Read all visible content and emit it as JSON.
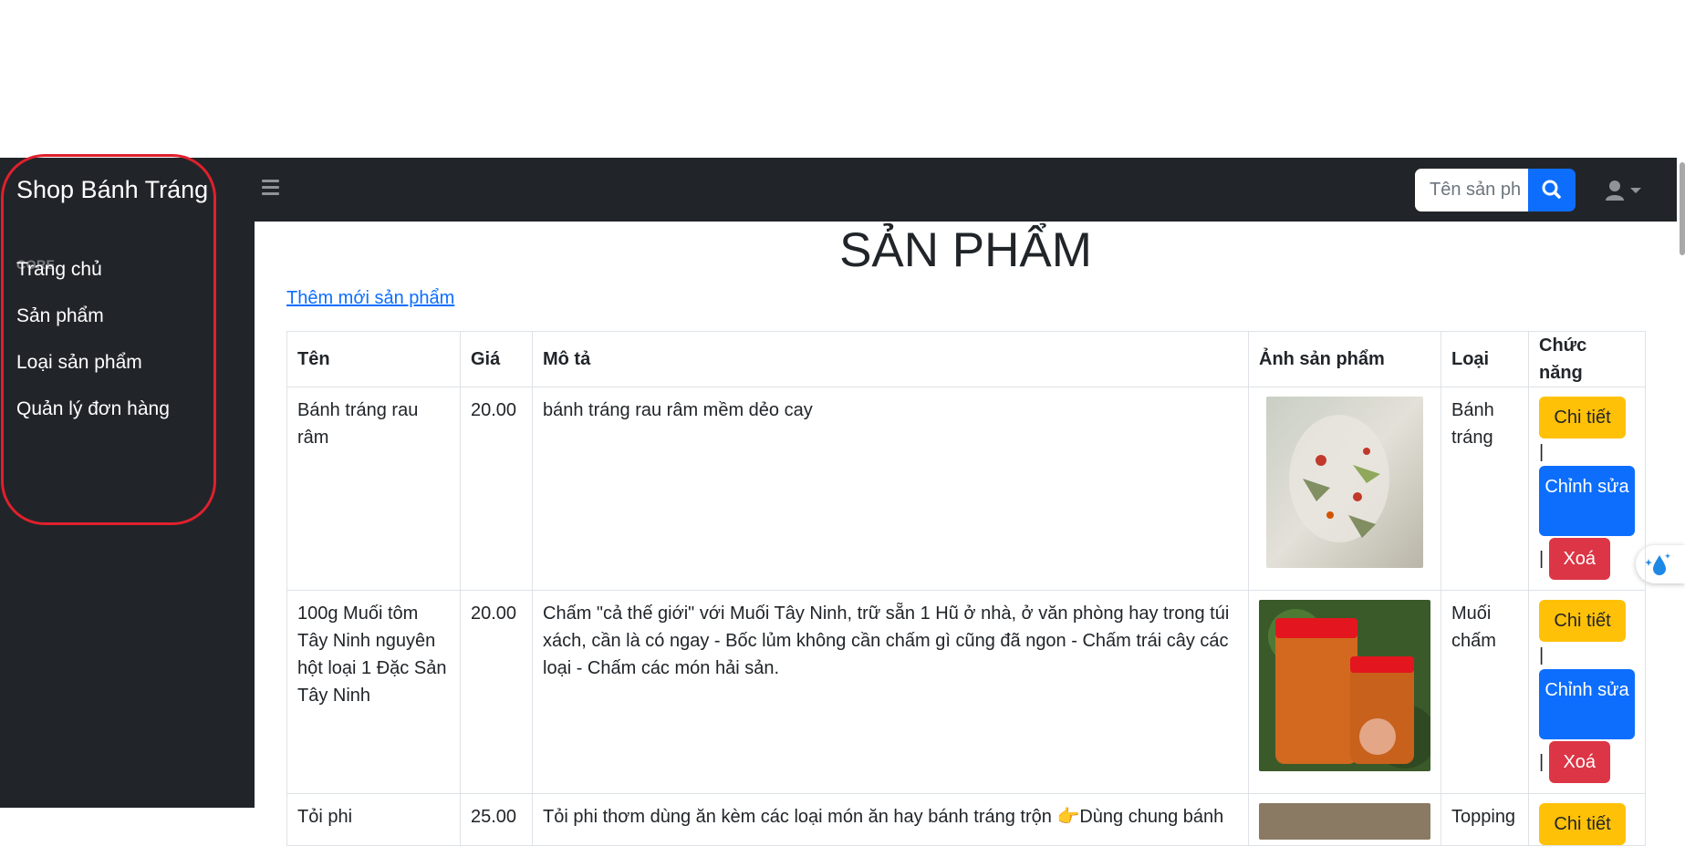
{
  "brand": "Shop Bánh Tráng",
  "sidebar": {
    "heading": "CORE",
    "items": [
      {
        "label": "Trang chủ"
      },
      {
        "label": "Sản phẩm"
      },
      {
        "label": "Loại sản phẩm"
      },
      {
        "label": "Quản lý đơn hàng"
      }
    ]
  },
  "search": {
    "placeholder": "Tên sản phẩm",
    "value": "Tên sản ph"
  },
  "icons": {
    "menu": "hamburger-icon",
    "search": "search-icon",
    "user": "user-icon",
    "dropdown": "caret-down-icon",
    "floating": "water-drop-sparkle-icon"
  },
  "main": {
    "title": "SẢN PHẨM",
    "add_link": "Thêm mới sản phẩm"
  },
  "table": {
    "headers": [
      "Tên",
      "Giá",
      "Mô tả",
      "Ảnh sản phẩm",
      "Loại",
      "Chức năng"
    ],
    "rows": [
      {
        "name": "Bánh tráng rau râm",
        "price": "20.00",
        "description": "bánh tráng rau râm mềm dẻo cay",
        "category": "Bánh tráng"
      },
      {
        "name": "100g Muối tôm Tây Ninh nguyên hột loại 1 Đặc Sản Tây Ninh",
        "price": "20.00",
        "description": "Chấm \"cả thế giới\" với Muối Tây Ninh, trữ sẵn 1 Hũ ở nhà, ở văn phòng hay trong túi xách, cần là có ngay - Bốc lủm không cần chấm gì cũng đã ngon - Chấm trái cây các loại - Chấm các món hải sản.",
        "category": "Muối chấm"
      },
      {
        "name": "Tỏi phi",
        "price": "25.00",
        "description": "Tỏi phi thơm dùng ăn kèm các loại món ăn hay bánh tráng trộn 👉Dùng chung bánh",
        "category": "Topping"
      }
    ],
    "actions": {
      "detail": "Chi tiết",
      "edit": "Chỉnh sửa",
      "delete": "Xoá",
      "separator": "|"
    }
  },
  "colors": {
    "sidebar_bg": "#212529",
    "primary": "#0d6efd",
    "warning": "#ffc107",
    "danger": "#dc3545",
    "annotation": "#e0202d"
  }
}
